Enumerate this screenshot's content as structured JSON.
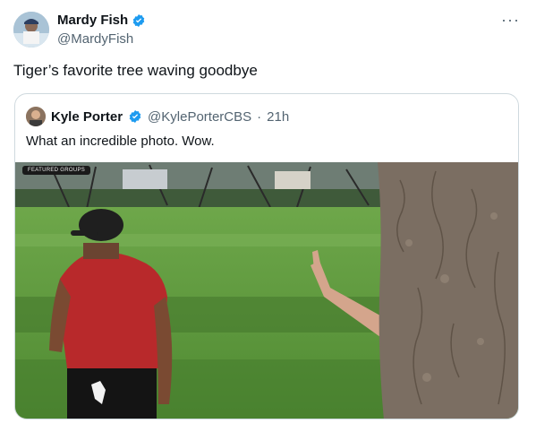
{
  "author": {
    "name": "Mardy Fish",
    "handle": "@MardyFish",
    "verified": true
  },
  "more_icon": "more-icon",
  "tweet": {
    "text": "Tiger’s favorite tree waving goodbye"
  },
  "quote": {
    "name": "Kyle Porter",
    "handle": "@KylePorterCBS",
    "separator": "·",
    "time": "21h",
    "text": "What an incredible photo. Wow.",
    "badge": "FEATURED GROUPS"
  },
  "colors": {
    "verified_blue": "#1d9bf0",
    "shirt_red": "#b22222",
    "grass": "#5f9a3c",
    "bark": "#7a6c5e"
  }
}
